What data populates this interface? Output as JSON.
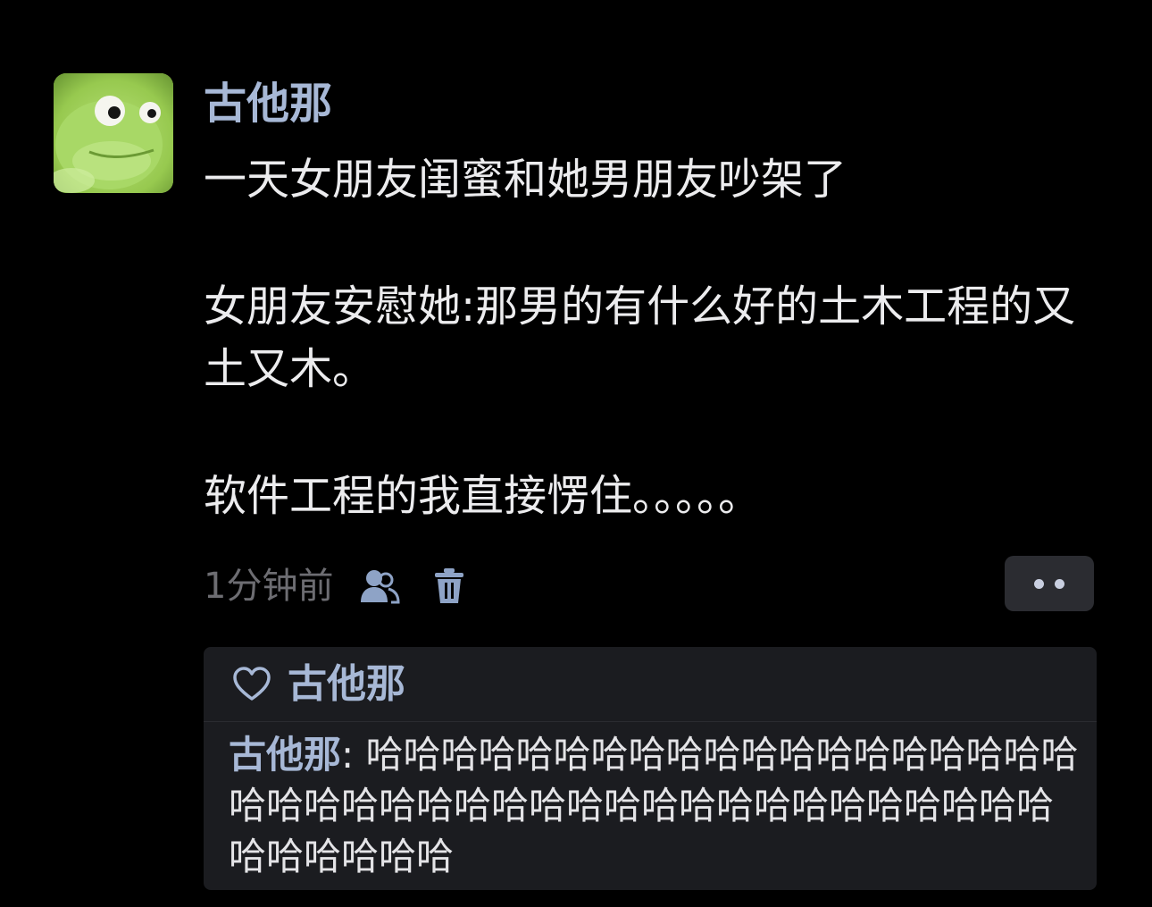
{
  "post": {
    "author": "古他那",
    "avatar_icon": "green-frog-avatar-icon",
    "paragraphs": [
      "一天女朋友闺蜜和她男朋友吵架了",
      "女朋友安慰她:那男的有什么好的土木工程的又土又木。",
      "软件工程的我直接愣住。。。。。"
    ],
    "timestamp": "1分钟前",
    "icons": {
      "visibility": "user-group-icon",
      "delete": "trash-icon",
      "more": "more-dots-icon"
    }
  },
  "likes": {
    "icon": "heart-icon",
    "names": "古他那"
  },
  "comments": [
    {
      "author": "古他那",
      "separator": ":",
      "text": " 哈哈哈哈哈哈哈哈哈哈哈哈哈哈哈哈哈哈哈哈哈哈哈哈哈哈哈哈哈哈哈哈哈哈哈哈哈哈哈哈哈哈哈哈哈哈哈"
    }
  ],
  "colors": {
    "background": "#000000",
    "name_link": "#a7b8d6",
    "body_text": "#ececee",
    "muted_text": "#6d6d72",
    "panel_bg": "#1b1c20",
    "more_button_bg": "#2b2c31"
  }
}
